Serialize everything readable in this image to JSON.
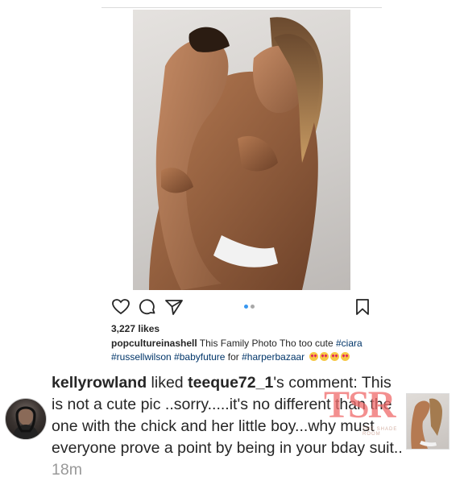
{
  "post": {
    "likes": "3,227 likes",
    "caption": {
      "username": "popcultureinashell",
      "text": " This Family Photo Tho too cute ",
      "tags": [
        "#ciara",
        "#russellwilson",
        "#babyfuture",
        "#harperbazaar"
      ],
      "connector": " for ",
      "emoji_count": 4
    },
    "icons": [
      "heart-icon",
      "comment-icon",
      "share-icon",
      "bookmark-icon"
    ],
    "carousel": {
      "pages": 2,
      "active": 1
    }
  },
  "activity": {
    "actor": "kellyrowland",
    "action": " liked ",
    "target": "teeque72_1",
    "suffix": "'s comment:",
    "comment": " This is not a cute pic ..sorry.....it's no different than the one with the chick and her little boy...why must everyone prove a point by being in your bday suit.. ",
    "time": "18m"
  },
  "watermark": {
    "letters": "TSR",
    "sub": "THE SHADE ROOM"
  },
  "colors": {
    "link": "#003569",
    "time": "#999999",
    "dot_active": "#3897f0",
    "dot_inactive": "#a8a8a8",
    "watermark": "#f06a6a"
  }
}
